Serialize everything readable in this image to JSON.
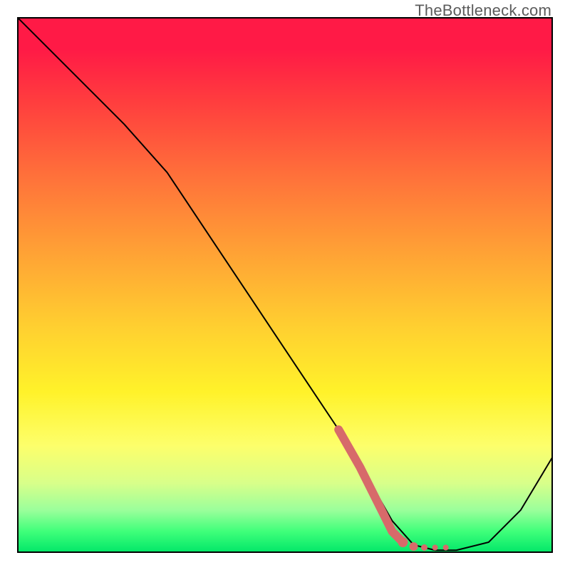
{
  "attribution": "TheBottleneck.com",
  "chart_data": {
    "type": "line",
    "title": "",
    "xlabel": "",
    "ylabel": "",
    "xlim": [
      0,
      100
    ],
    "ylim": [
      0,
      100
    ],
    "series": [
      {
        "name": "bottleneck-curve",
        "x": [
          0,
          12,
          20,
          28,
          36,
          44,
          52,
          60,
          66,
          70,
          74,
          78,
          82,
          88,
          94,
          100
        ],
        "y": [
          100,
          88,
          80,
          71,
          59,
          47,
          35,
          23,
          13,
          6,
          1.5,
          0.5,
          0.5,
          2,
          8,
          18
        ]
      }
    ],
    "highlight_segment": {
      "name": "sweet-spot",
      "color": "#d76a6a",
      "x": [
        60,
        64,
        68,
        70,
        72,
        74,
        76,
        78,
        80
      ],
      "y": [
        23,
        16,
        8,
        4,
        2,
        1.2,
        1.0,
        1.0,
        1.0
      ]
    }
  }
}
